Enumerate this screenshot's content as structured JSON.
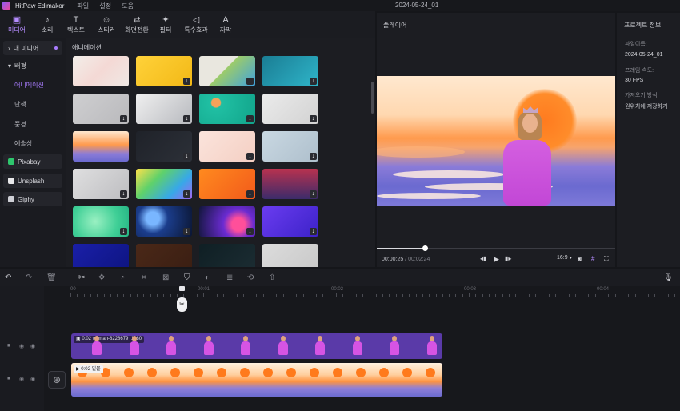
{
  "titlebar": {
    "app": "HitPaw Edimakor",
    "menu": [
      "파일",
      "설정",
      "도움"
    ],
    "date": "2024-05-24_01"
  },
  "toolbar": [
    {
      "label": "미디어",
      "icon": "media-icon"
    },
    {
      "label": "소리",
      "icon": "music-icon"
    },
    {
      "label": "텍스트",
      "icon": "text-icon"
    },
    {
      "label": "스티커",
      "icon": "sticker-icon"
    },
    {
      "label": "화면전환",
      "icon": "transition-icon"
    },
    {
      "label": "필터",
      "icon": "filter-icon"
    },
    {
      "label": "특수효과",
      "icon": "effect-icon"
    },
    {
      "label": "자막",
      "icon": "subtitle-icon"
    }
  ],
  "leftnav": {
    "my_media": "내 미디어",
    "background": "배경",
    "subitems": [
      "애니메이션",
      "단색",
      "풍경",
      "예술성"
    ],
    "selected_sub": "애니메이션",
    "sources": [
      "Pixabay",
      "Unsplash",
      "Giphy"
    ]
  },
  "media": {
    "header": "애니메이션"
  },
  "player": {
    "title": "플레이어",
    "current_time": "00:00:25",
    "separator": " / ",
    "total_time": "00:02:24",
    "aspect": "16:9",
    "progress": 0.2
  },
  "project": {
    "title": "프로젝트 정보",
    "name_label": "파일이름:",
    "name_value": "2024-05-24_01",
    "fps_label": "프레임 속도:",
    "fps_value": "30 FPS",
    "import_label": "가져오기 방식:",
    "import_value": "원위치에 저장하기"
  },
  "timeline": {
    "ruler": [
      "00",
      "00:01",
      "00:02",
      "00:03",
      "00:04"
    ],
    "clip1_label": "0:02 woman-8228679_1280",
    "clip2_label": "0:02 일몰"
  },
  "colors": {
    "accent": "#a97dff",
    "clip": "#5a3aa8"
  }
}
